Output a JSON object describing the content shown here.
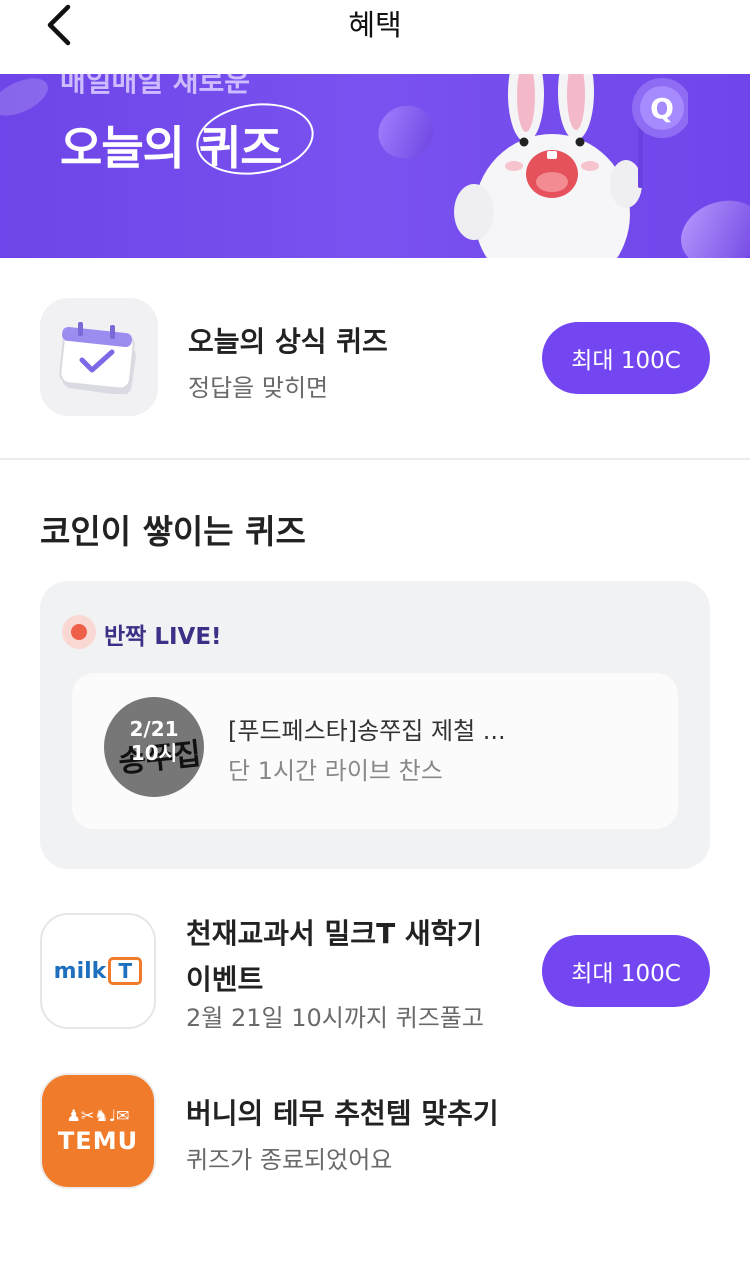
{
  "header": {
    "title": "혜택",
    "back_icon": "chevron-left-icon"
  },
  "banner": {
    "subtitle": "매일매일 새로운",
    "title": "오늘의 퀴즈",
    "mascot_icon": "bunny-mascot",
    "badge_letter": "Q",
    "colors": {
      "background": "#7046ea",
      "accent": "#7346f2"
    }
  },
  "daily_quiz": {
    "icon": "calendar-check-icon",
    "title": "오늘의 상식 퀴즈",
    "subtitle": "정답을 맞히면",
    "button_label": "최대 100C"
  },
  "coin_section": {
    "title": "코인이 쌓이는 퀴즈",
    "live": {
      "badge_label": "반짝 LIVE!",
      "item": {
        "thumb_date": "2/21",
        "thumb_time": "10시",
        "title": "[푸드페스타]송쭈집 제철 ...",
        "subtitle": "단 1시간 라이브 찬스"
      }
    },
    "items": [
      {
        "logo": "milkT-logo",
        "logo_text": "milk",
        "logo_t": "T",
        "title_line1": "천재교과서 밀크T 새학기",
        "title_line2": "이벤트",
        "subtitle": "2월 21일 10시까지 퀴즈풀고",
        "button_label": "최대 100C"
      },
      {
        "logo": "temu-logo",
        "logo_text": "TEMU",
        "title": "버니의 테무 추천템 맞추기",
        "subtitle": "퀴즈가 종료되었어요"
      }
    ]
  }
}
